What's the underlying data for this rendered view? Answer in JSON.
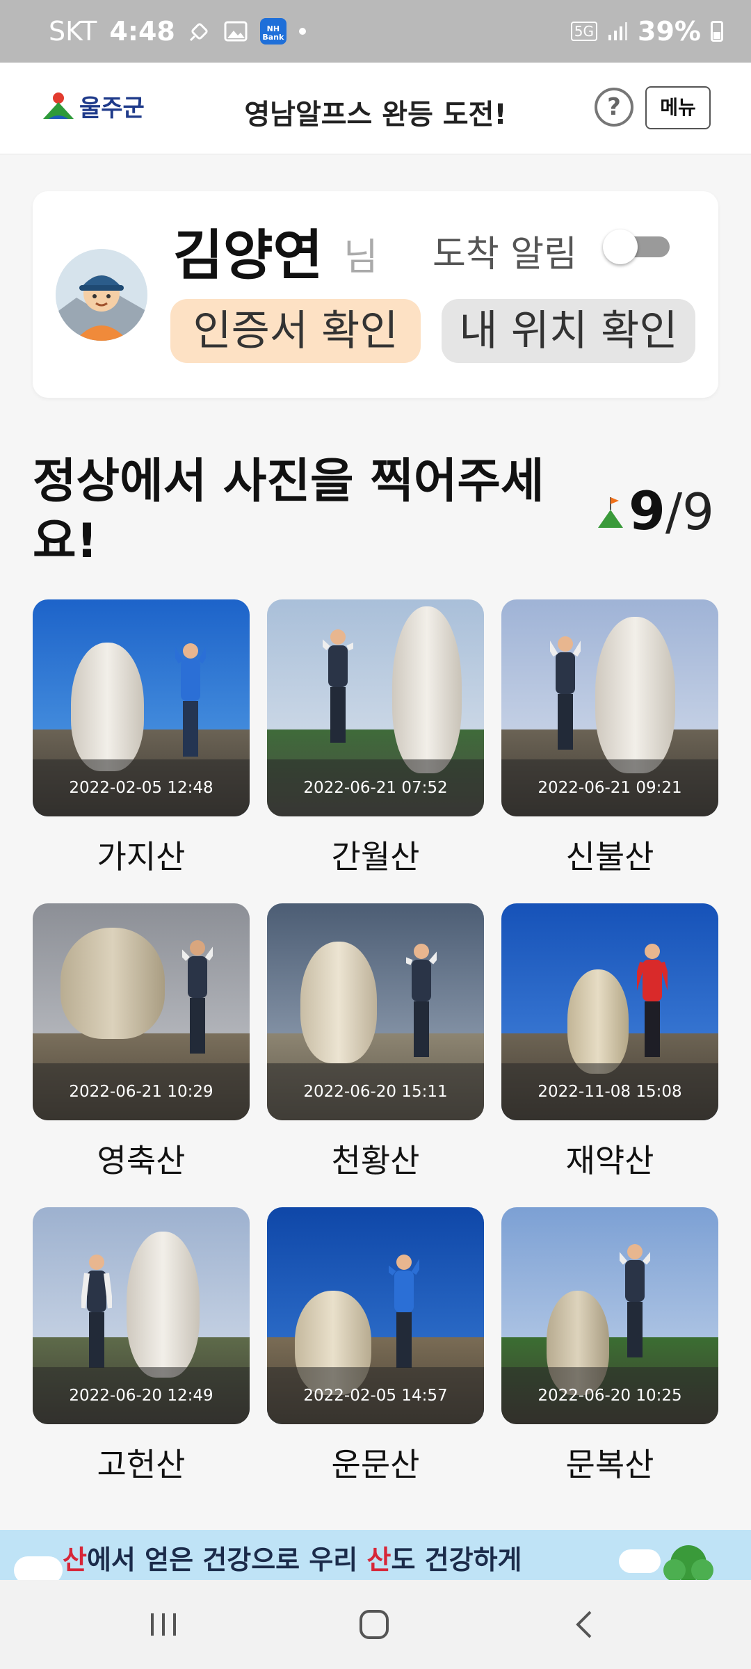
{
  "status_bar": {
    "carrier": "SKT",
    "time": "4:48",
    "network": "5G",
    "battery": "39%"
  },
  "header": {
    "logo_text": "울주군",
    "title": "영남알프스 완등 도전!",
    "help": "?",
    "menu": "메뉴"
  },
  "profile": {
    "name": "김양연",
    "honorific": "님",
    "notify_label": "도착 알림",
    "notify_on": false,
    "cert_button": "인증서 확인",
    "location_button": "내 위치 확인"
  },
  "section": {
    "title": "정상에서 사진을 찍어주세요!",
    "done": "9",
    "separator": "/",
    "total": "9"
  },
  "mountains": [
    {
      "name": "가지산",
      "date": "2022-02-05 12:48"
    },
    {
      "name": "간월산",
      "date": "2022-06-21 07:52"
    },
    {
      "name": "신불산",
      "date": "2022-06-21 09:21"
    },
    {
      "name": "영축산",
      "date": "2022-06-21 10:29"
    },
    {
      "name": "천황산",
      "date": "2022-06-20 15:11"
    },
    {
      "name": "재약산",
      "date": "2022-11-08 15:08"
    },
    {
      "name": "고헌산",
      "date": "2022-06-20 12:49"
    },
    {
      "name": "운문산",
      "date": "2022-02-05 14:57"
    },
    {
      "name": "문복산",
      "date": "2022-06-20 10:25"
    }
  ],
  "banner": {
    "part1": "산",
    "part2": "에서 얻은 건강으로 우리 ",
    "part3": "산",
    "part4": "도 건강하게"
  },
  "colors": {
    "cert_bg": "#fde1c4",
    "location_bg": "#e5e5e5",
    "banner_bg": "#bfe3f6",
    "accent_red": "#d72638"
  }
}
